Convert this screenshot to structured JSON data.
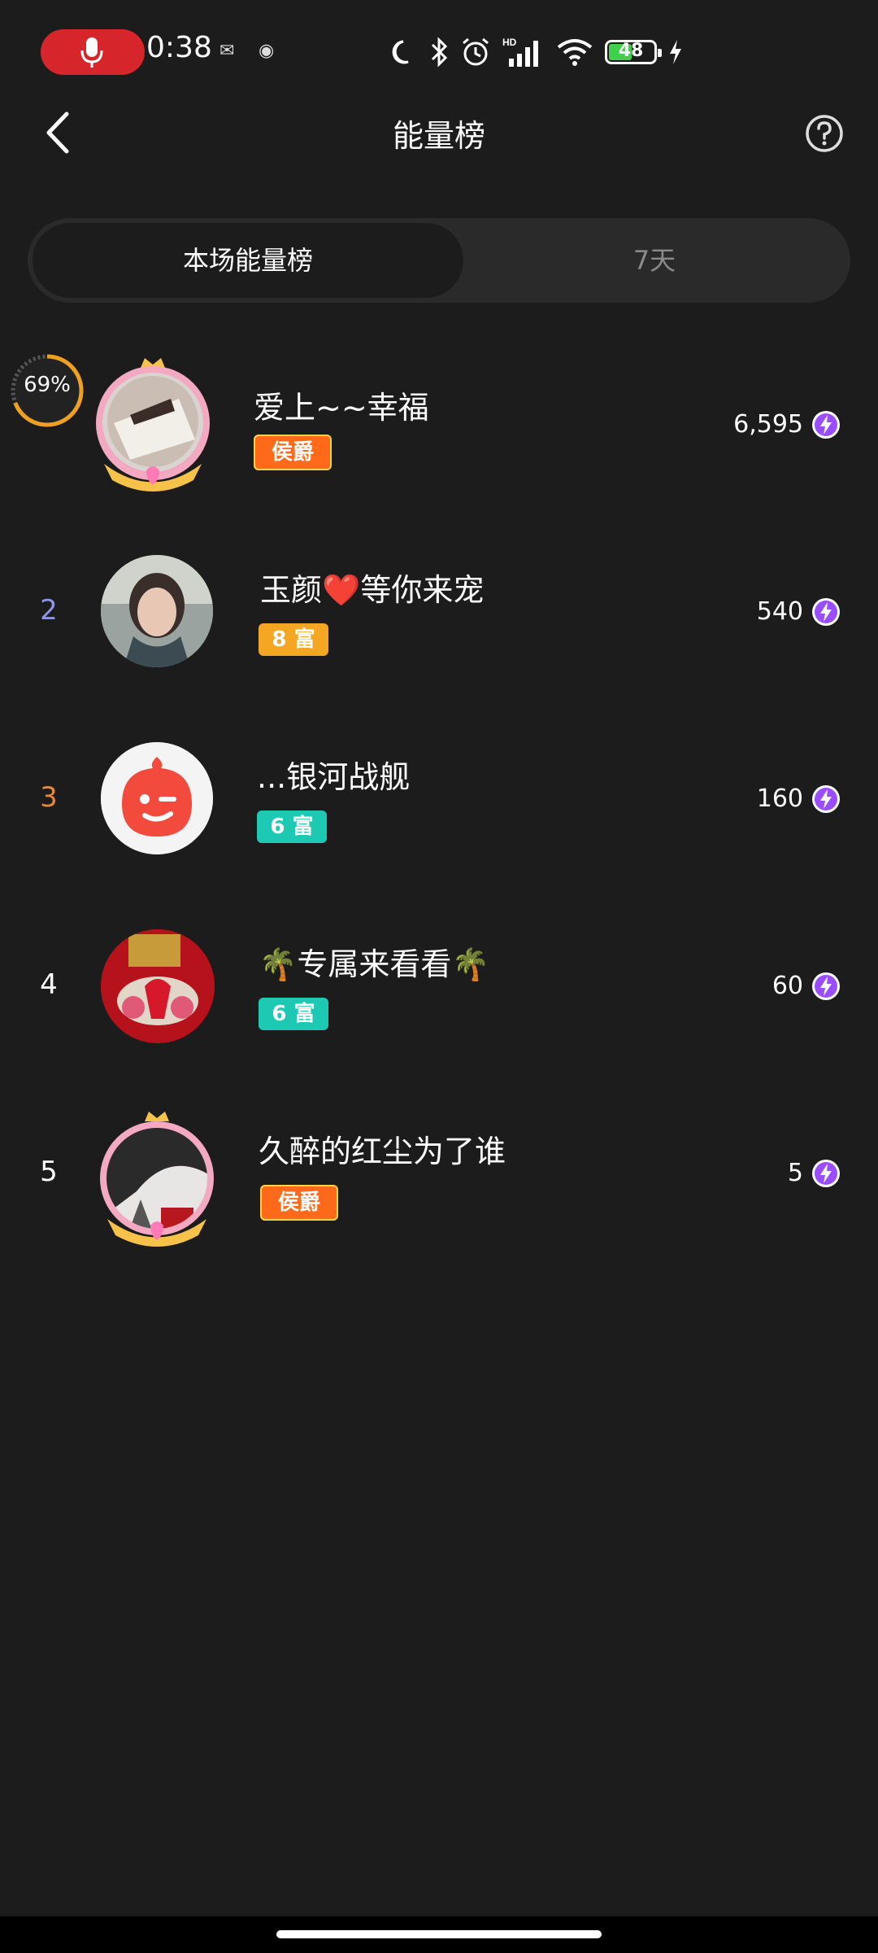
{
  "status_bar": {
    "time": "0:38",
    "battery": "48",
    "icons": [
      "microphone-icon",
      "moon-icon",
      "bluetooth-icon",
      "alarm-icon",
      "hd-signal-icon",
      "wifi-icon",
      "battery-icon",
      "charging-icon"
    ]
  },
  "header": {
    "title": "能量榜"
  },
  "tabs": [
    {
      "label": "本场能量榜",
      "active": true
    },
    {
      "label": "7天",
      "active": false
    }
  ],
  "progress": {
    "text": "69%",
    "value": 0.69
  },
  "ranking": [
    {
      "rank": "",
      "name": "爱上~~幸福",
      "badge": "侯爵",
      "badge_type": "noble",
      "score": "6,595"
    },
    {
      "rank": "2",
      "name": "玉颜❤️等你来宠",
      "badge": "8 富",
      "badge_type": "rich-gold",
      "score": "540"
    },
    {
      "rank": "3",
      "name": "...银河战舰",
      "badge": "6 富",
      "badge_type": "rich-teal",
      "score": "160"
    },
    {
      "rank": "4",
      "name": "🌴专属来看看🌴",
      "badge": "6 富",
      "badge_type": "rich-teal",
      "score": "60"
    },
    {
      "rank": "5",
      "name": "久醉的红尘为了谁",
      "badge": "侯爵",
      "badge_type": "noble",
      "score": "5"
    }
  ],
  "colors": {
    "background": "#1c1c1c",
    "rank2": "#8f95e8",
    "rank3": "#e6883a",
    "badge_gold": "#f5a623",
    "badge_teal": "#1ec9b4",
    "badge_noble": "#ff6a1a",
    "energy_icon": "#9a4dff"
  }
}
